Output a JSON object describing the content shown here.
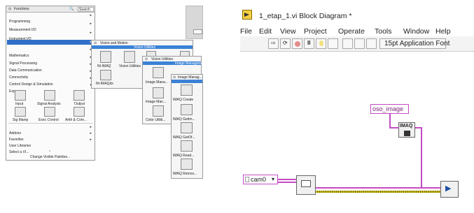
{
  "functions_palette": {
    "title": "Functions",
    "search_label": "Search",
    "categories": [
      "Programming",
      "Measurement I/O",
      "Instrument I/O",
      "Vision and Motion",
      "Mathematics",
      "Signal Processing",
      "Data Communication",
      "Connectivity",
      "Control Design & Simulation",
      "Express"
    ],
    "express_icons": [
      "Input",
      "Signal Analysis",
      "Output",
      "Sig Manip",
      "Exec Control",
      "Arith & Com..."
    ],
    "lower_items": [
      "Addons",
      "Favorites",
      "User Libraries",
      "Select a VI..."
    ],
    "change_palettes": "Change Visible Palettes..."
  },
  "vision_motion_palette": {
    "title": "Vision and Motion",
    "band_label": "Vision Utilities",
    "icons": [
      "NI-IMAQ",
      "Vision Utilities",
      "NI-IMAQdx"
    ]
  },
  "vision_utilities_palette": {
    "title": "Vision Utilities",
    "band_label": "Image Management",
    "icons": [
      "Image Mana...",
      "Image Man...",
      "Color Utiliti..."
    ]
  },
  "image_management_palette": {
    "title": "Image Manag...",
    "icons": [
      "IMAQ Create",
      "IMAQ Getim...",
      "IMAQ GetOf...",
      "IMAQ Read...",
      "IMAQ Remov..."
    ]
  },
  "block_diagram": {
    "title": "1_etap_1.vi Block Diagram *",
    "menus": [
      "File",
      "Edit",
      "View",
      "Project",
      "Operate",
      "Tools",
      "Window",
      "Help"
    ],
    "font_selector": "15pt Application Font",
    "string_constant": "oso_image",
    "imaq_label": "IMAQ",
    "camera_control": "cam0"
  },
  "colors": {
    "wire_pink": "#c44bc4",
    "wire_yellow": "#c8b400",
    "palette_highlight": "#2f6fc7",
    "band_blue": "#3b82d6"
  }
}
